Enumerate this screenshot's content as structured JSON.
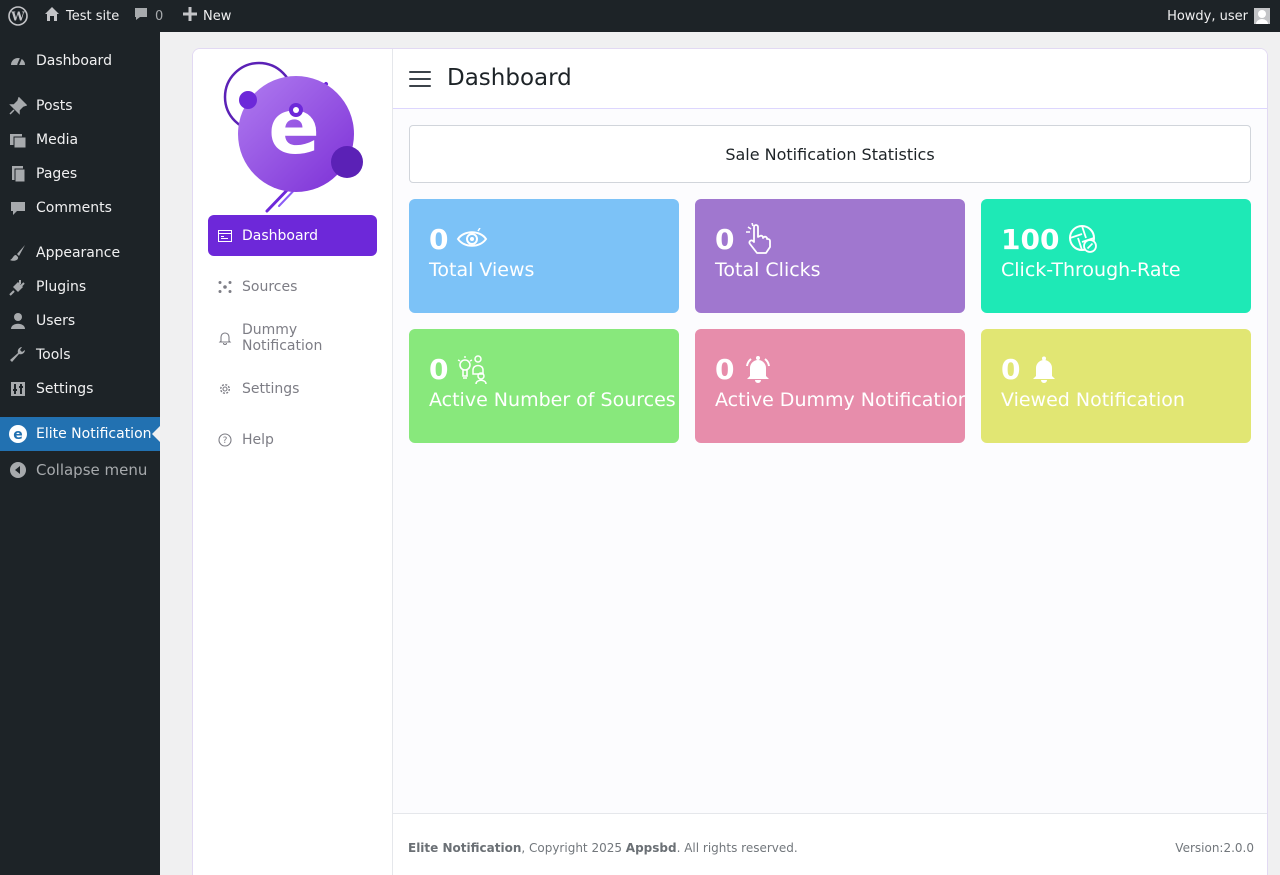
{
  "adminbar": {
    "site_name": "Test site",
    "comments_count": "0",
    "new_label": "New",
    "howdy": "Howdy, user"
  },
  "wp_menu": {
    "items": [
      {
        "label": "Dashboard",
        "icon": "dashboard-icon"
      },
      {
        "label": "Posts",
        "icon": "pin-icon"
      },
      {
        "label": "Media",
        "icon": "media-icon"
      },
      {
        "label": "Pages",
        "icon": "pages-icon"
      },
      {
        "label": "Comments",
        "icon": "comment-icon"
      },
      {
        "label": "Appearance",
        "icon": "brush-icon"
      },
      {
        "label": "Plugins",
        "icon": "plug-icon"
      },
      {
        "label": "Users",
        "icon": "user-icon"
      },
      {
        "label": "Tools",
        "icon": "wrench-icon"
      },
      {
        "label": "Settings",
        "icon": "settings-icon"
      },
      {
        "label": "Elite Notification",
        "icon": "elite-logo-icon",
        "active": true
      }
    ],
    "collapse_label": "Collapse menu"
  },
  "plugin_nav": {
    "items": [
      {
        "label": "Dashboard",
        "icon": "dashboard-card-icon",
        "active": true
      },
      {
        "label": "Sources",
        "icon": "sources-icon"
      },
      {
        "label": "Dummy Notification",
        "icon": "bell-icon"
      },
      {
        "label": "Settings",
        "icon": "gear-icon"
      },
      {
        "label": "Help",
        "icon": "help-icon"
      }
    ]
  },
  "header": {
    "title": "Dashboard"
  },
  "stats": {
    "title": "Sale Notification Statistics",
    "cards": [
      {
        "value": "0",
        "label": "Total Views",
        "icon": "eye-icon",
        "color": "#7cc2f7"
      },
      {
        "value": "0",
        "label": "Total Clicks",
        "icon": "pointer-click-icon",
        "color": "#a077cf"
      },
      {
        "value": "100",
        "label": "Click-Through-Rate",
        "icon": "aperture-icon",
        "color": "#1ee9b6"
      },
      {
        "value": "0",
        "label": "Active Number of Sources",
        "icon": "idea-people-icon",
        "color": "#88e87c"
      },
      {
        "value": "0",
        "label": "Active Dummy Notifications",
        "icon": "bell-ring-icon",
        "color": "#e78dab"
      },
      {
        "value": "0",
        "label": "Viewed Notification",
        "icon": "bell-icon",
        "color": "#e1e673"
      }
    ]
  },
  "footer": {
    "brand": "Elite Notification",
    "copyright": ", Copyright 2025 ",
    "company": "Appsbd",
    "rights": ". All rights reserved.",
    "version": "Version:2.0.0"
  },
  "colors": {
    "wp_dark": "#1d2327",
    "wp_blue": "#2271b1",
    "accent_purple": "#6d28d9"
  }
}
